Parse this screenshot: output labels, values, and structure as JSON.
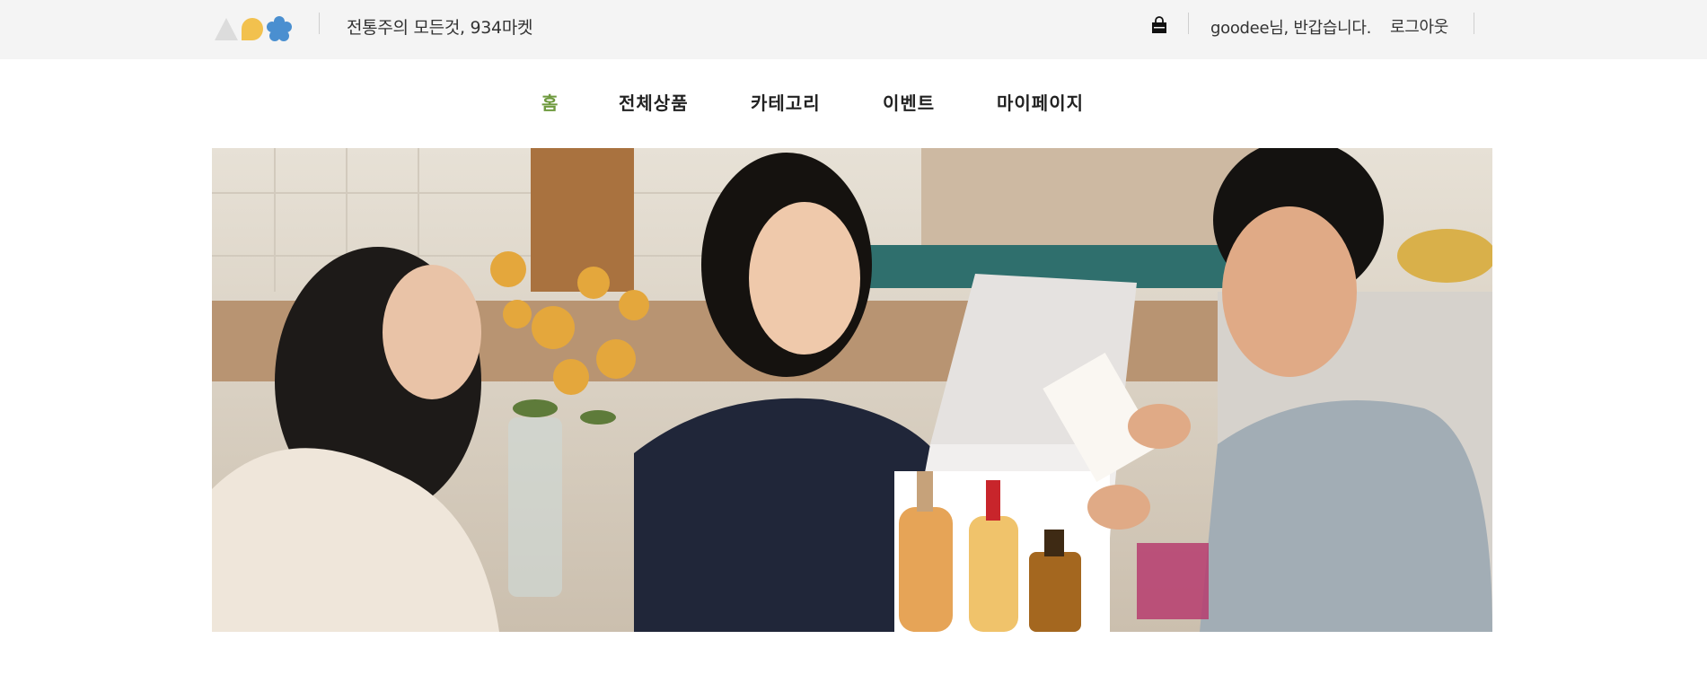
{
  "header": {
    "logo_icon": "shapes-logo-icon",
    "tagline": "전통주의 모든것, 934마켓",
    "cart_icon": "shopping-bag-icon",
    "greeting_user": "goodee",
    "greeting_suffix": "님, 반갑습니다.",
    "logout_label": "로그아웃"
  },
  "nav": {
    "items": [
      {
        "label": "홈",
        "active": true
      },
      {
        "label": "전체상품",
        "active": false
      },
      {
        "label": "카테고리",
        "active": false
      },
      {
        "label": "이벤트",
        "active": false
      },
      {
        "label": "마이페이지",
        "active": false
      }
    ]
  },
  "hero": {
    "image": "hero-banner-photo"
  },
  "colors": {
    "topbar_bg": "#f4f4f4",
    "nav_active": "#6f9a3f",
    "logo_gray": "#dcdcdc",
    "logo_yellow": "#f2c14e",
    "logo_blue": "#4a8fd0"
  }
}
